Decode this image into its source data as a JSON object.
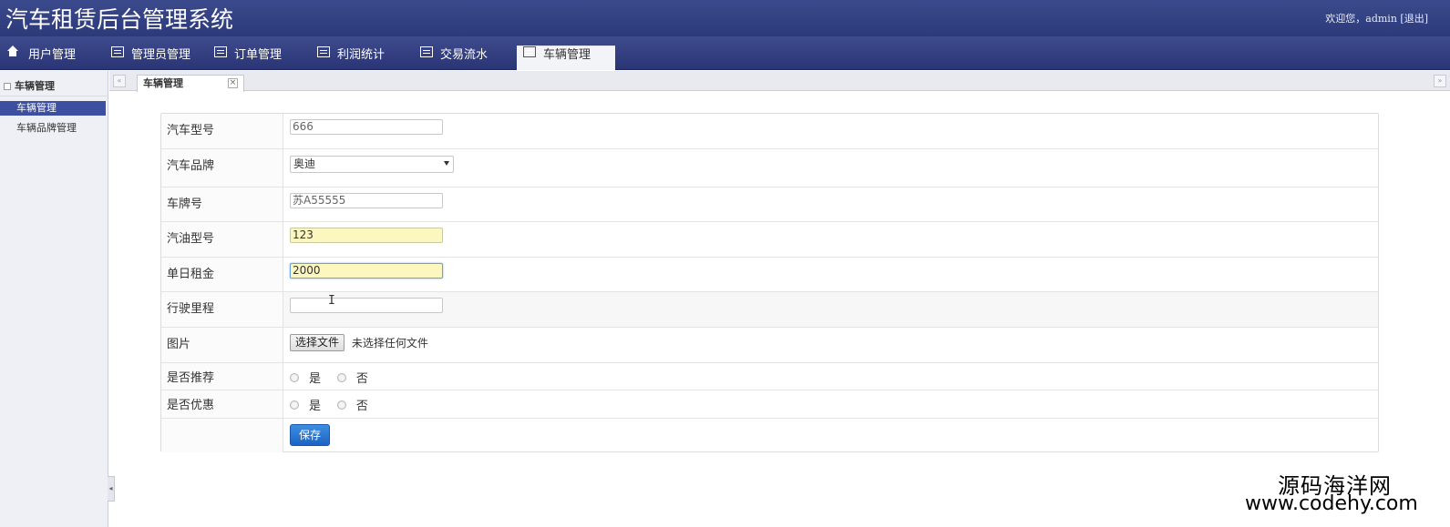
{
  "app": {
    "title": "汽车租赁后台管理系统",
    "welcome": "欢迎您，admin [退出]"
  },
  "nav": {
    "items": [
      {
        "label": "用户管理",
        "icon": "home-icon"
      },
      {
        "label": "管理员管理",
        "icon": "list-icon"
      },
      {
        "label": "订单管理",
        "icon": "list-icon"
      },
      {
        "label": "利润统计",
        "icon": "list-icon"
      },
      {
        "label": "交易流水",
        "icon": "list-icon"
      },
      {
        "label": "车辆管理",
        "icon": "list-icon"
      }
    ],
    "active_index": 5
  },
  "sidebar": {
    "section": "车辆管理",
    "items": [
      {
        "label": "车辆管理",
        "selected": true
      },
      {
        "label": "车辆品牌管理",
        "selected": false
      }
    ]
  },
  "tabs": {
    "open": [
      {
        "label": "车辆管理",
        "close": "×"
      }
    ],
    "left_arrow": "«",
    "right_arrow": "»"
  },
  "form": {
    "model": {
      "label": "汽车型号",
      "value": "666"
    },
    "brand": {
      "label": "汽车品牌",
      "value": "奥迪"
    },
    "plate": {
      "label": "车牌号",
      "value": "苏A55555"
    },
    "fuel": {
      "label": "汽油型号",
      "value": "123"
    },
    "daily_rent": {
      "label": "单日租金",
      "value": "2000"
    },
    "mileage": {
      "label": "行驶里程",
      "value": ""
    },
    "image": {
      "label": "图片",
      "button": "选择文件",
      "note": "未选择任何文件"
    },
    "recommend": {
      "label": "是否推荐",
      "yes": "是",
      "no": "否"
    },
    "discount": {
      "label": "是否优惠",
      "yes": "是",
      "no": "否"
    },
    "save_label": "保存"
  },
  "watermark": {
    "line1": "源码海洋网",
    "line2": "www.codehy.com"
  }
}
